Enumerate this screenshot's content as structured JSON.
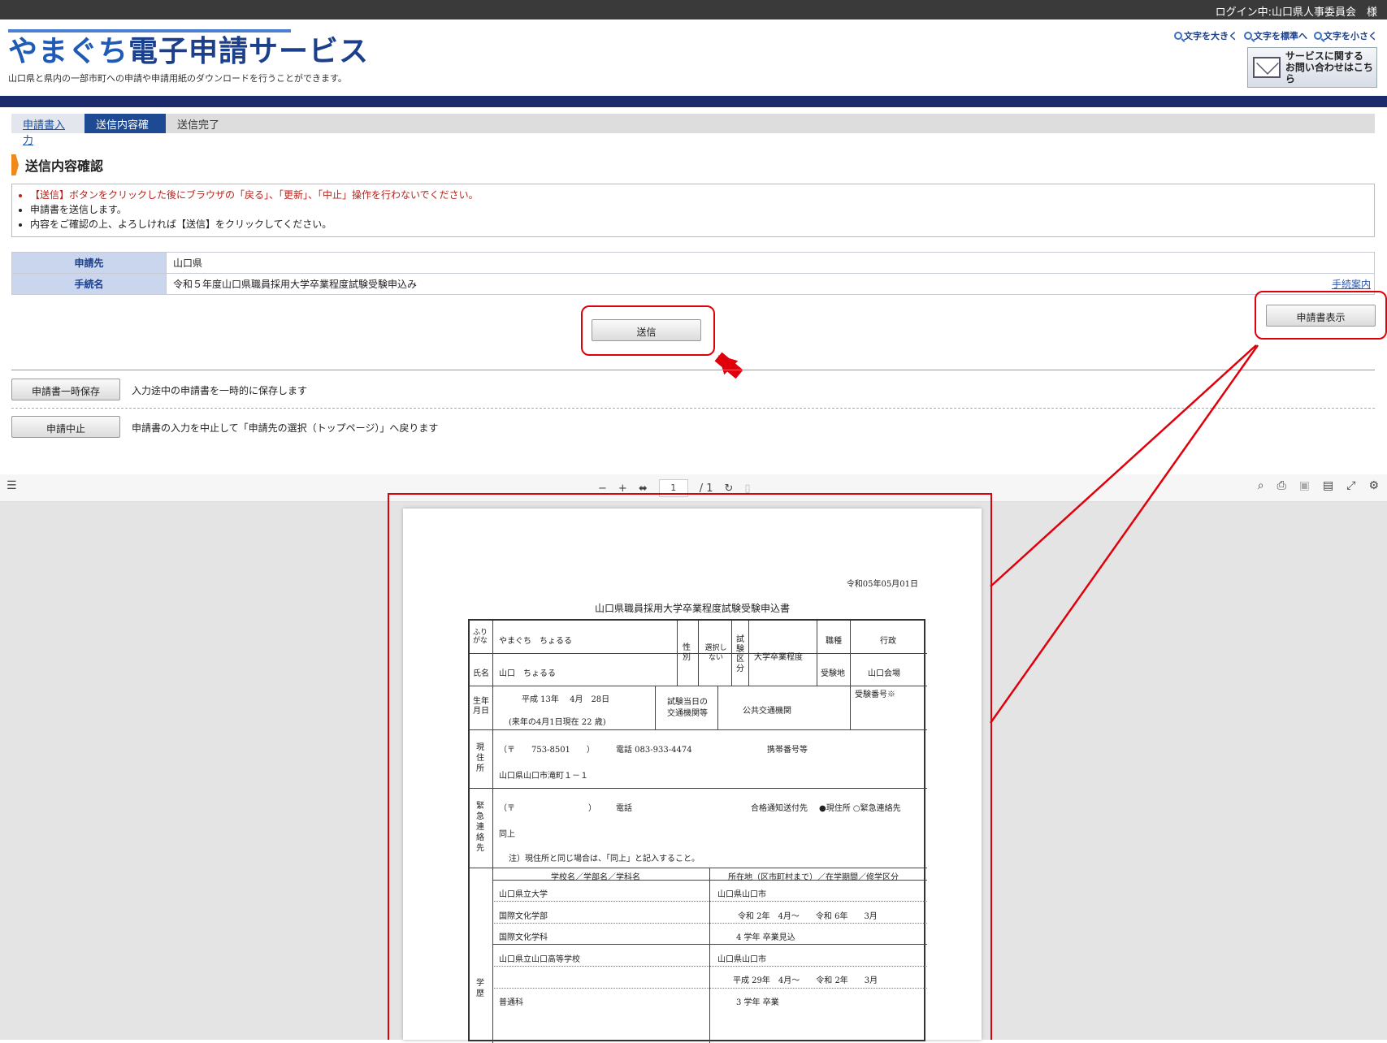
{
  "header": {
    "login_status": "ログイン中:山口県人事委員会　様",
    "title_part1": "やまぐち",
    "title_part2": "電子申請サービス",
    "subtitle": "山口県と県内の一部市町への申請や申請用紙のダウンロードを行うことができます。",
    "font_links": [
      "文字を大きく",
      "文字を標準へ",
      "文字を小さく"
    ],
    "contact_line1": "サービスに関する",
    "contact_line2": "お問い合わせはこちら"
  },
  "steps": [
    "申請書入力",
    "送信内容確認",
    "送信完了"
  ],
  "section_title": "送信内容確認",
  "notices": [
    "【送信】ボタンをクリックした後にブラウザの「戻る」、「更新」、「中止」操作を行わないでください。",
    "申請書を送信します。",
    "内容をご確認の上、よろしければ【送信】をクリックしてください。"
  ],
  "info": {
    "dest_label": "申請先",
    "dest_value": "山口県",
    "proc_label": "手続名",
    "proc_value": "令和５年度山口県職員採用大学卒業程度試験受験申込み",
    "manual_link": "手続案内"
  },
  "buttons": {
    "send": "送信",
    "view": "申請書表示",
    "save": "申請書一時保存",
    "save_desc": "入力途中の申請書を一時的に保存します",
    "cancel": "申請中止",
    "cancel_desc": "申請書の入力を中止して「申請先の選択（トップページ）」へ戻ります"
  },
  "pdf_toolbar": {
    "minus": "−",
    "plus": "+",
    "page": "1",
    "total": "/ 1"
  },
  "form": {
    "date": "令和05年05月01日",
    "title": "山口県職員採用大学卒業程度試験受験申込書",
    "furigana_label": "ふり\nがな",
    "furigana": "やまぐち　ちょるる",
    "gender_label": "性\n別",
    "gender_value": "選択し\nない",
    "exam_label": "試\n験\n区\n分",
    "exam_value": "大学卒業程度",
    "job_label": "職種",
    "job_value": "行政",
    "name_label": "氏名",
    "name": "山口　ちょるる",
    "site_label": "受験地",
    "site_value": "山口会場",
    "birth_label": "生年\n月日",
    "birth": "平成 13年　 4月　28日",
    "age": "(来年の4月1日現在 22 歳)",
    "transport_label": "試験当日の\n交通機関等",
    "transport_value": "公共交通機関",
    "exam_no_label": "受験番号※",
    "address_label": "現\n住\n所",
    "zip": "（〒　　753-8501　　）",
    "phone": "電話 083-933-4474",
    "mobile_label": "携帯番号等",
    "address": "山口県山口市滝町１－１",
    "emergency_label": "緊\n急\n連\n絡\n先",
    "em_zip": "（〒　　　　　　　　　）",
    "em_phone": "電話",
    "notify_label": "合格通知送付先",
    "notify_value": "●現住所 ○緊急連絡先",
    "em_value": "同上",
    "em_note": "注）現住所と同じ場合は、「同上」と記入すること。",
    "edu_label": "学\n歴",
    "edu_header_left": "学校名／学部名／学科名",
    "edu_header_right": "所在地（区市町村まで）／在学期間／修学区分",
    "edu_rows": [
      [
        "山口県立大学",
        "山口県山口市"
      ],
      [
        "国際文化学部",
        "令和 2年　4月～　　令和 6年　　3月"
      ],
      [
        "国際文化学科",
        "4 学年 卒業見込"
      ],
      [
        "山口県立山口高等学校",
        "山口県山口市"
      ],
      [
        "",
        "平成 29年　4月～　　令和 2年　　3月"
      ],
      [
        "普通科",
        "3 学年 卒業"
      ]
    ]
  }
}
